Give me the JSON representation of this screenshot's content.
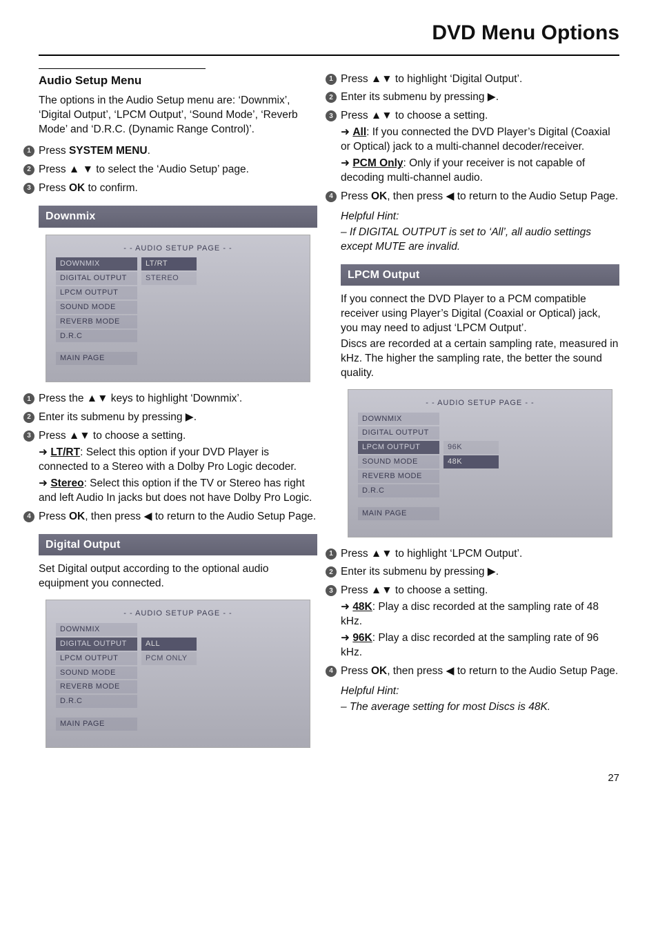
{
  "page": {
    "title": "DVD Menu Options",
    "number": "27"
  },
  "left": {
    "heading": "Audio Setup Menu",
    "intro": "The options in the Audio Setup menu are: ‘Downmix’, ‘Digital Output’, ‘LPCM Output’, ‘Sound Mode’, ‘Reverb Mode’ and ‘D.R.C. (Dynamic Range Control)’.",
    "step1_a": "Press ",
    "step1_b": "SYSTEM MENU",
    "step1_c": ".",
    "step2": "Press ▲ ▼ to select the ‘Audio Setup’ page.",
    "step3_a": "Press ",
    "step3_b": "OK",
    "step3_c": " to confirm.",
    "sub_downmix": "Downmix",
    "osd1": {
      "title": "- - AUDIO SETUP PAGE - -",
      "items": [
        "DOWNMIX",
        "DIGITAL OUTPUT",
        "LPCM OUTPUT",
        "SOUND MODE",
        "REVERB MODE",
        "D.R.C"
      ],
      "opts": [
        "LT/RT",
        "STEREO"
      ],
      "sel_item": 0,
      "sel_opt": 0,
      "main": "MAIN PAGE"
    },
    "d1": "Press the ▲▼ keys to highlight ‘Downmix’.",
    "d2": "Enter its submenu by pressing ▶.",
    "d3": "Press ▲▼ to choose a setting.",
    "d3_opt1_lab": "LT/RT",
    "d3_opt1_txt": ": Select this option if your DVD Player is connected to a Stereo with a Dolby Pro Logic decoder.",
    "d3_opt2_lab": "Stereo",
    "d3_opt2_txt": ": Select this option if the TV or Stereo has right and left Audio In jacks but does not have Dolby Pro Logic.",
    "d4_a": "Press ",
    "d4_b": "OK",
    "d4_c": ", then press ◀ to return to the Audio Setup Page.",
    "sub_digital": "Digital Output",
    "digital_intro": "Set Digital output according to the optional audio equipment you connected.",
    "osd2": {
      "title": "- - AUDIO SETUP PAGE - -",
      "items": [
        "DOWNMIX",
        "DIGITAL OUTPUT",
        "LPCM OUTPUT",
        "SOUND MODE",
        "REVERB MODE",
        "D.R.C"
      ],
      "opts": [
        "ALL",
        "PCM ONLY"
      ],
      "sel_item": 1,
      "sel_opt": 0,
      "main": "MAIN PAGE"
    }
  },
  "right": {
    "g1": "Press ▲▼ to highlight ‘Digital Output’.",
    "g2": "Enter its submenu by pressing ▶.",
    "g3": "Press ▲▼ to choose a setting.",
    "g3_opt1_lab": "All",
    "g3_opt1_txt": ": If you connected the DVD Player’s Digital (Coaxial or Optical) jack to a multi-channel decoder/receiver.",
    "g3_opt2_lab": "PCM Only",
    "g3_opt2_txt": ": Only if your receiver is not capable of decoding multi-channel audio.",
    "g4_a": "Press ",
    "g4_b": "OK",
    "g4_c": ", then press ◀ to return to the Audio Setup Page.",
    "hint1_head": "Helpful Hint:",
    "hint1_body": "–   If DIGITAL OUTPUT is set to ‘All’, all audio settings except MUTE are invalid.",
    "sub_lpcm": "LPCM Output",
    "lpcm_p1": "If you connect the DVD Player to a PCM compatible receiver using Player’s Digital (Coaxial or Optical) jack, you may need to adjust ‘LPCM Output’.",
    "lpcm_p2": "Discs are recorded at a certain sampling rate, measured in kHz. The higher the sampling rate, the better the sound quality.",
    "osd3": {
      "title": "- - AUDIO SETUP PAGE - -",
      "items": [
        "DOWNMIX",
        "DIGITAL OUTPUT",
        "LPCM OUTPUT",
        "SOUND MODE",
        "REVERB MODE",
        "D.R.C"
      ],
      "opts": [
        "96K",
        "48K"
      ],
      "sel_item": 2,
      "sel_opt": 1,
      "main": "MAIN PAGE"
    },
    "l1": "Press ▲▼ to highlight ‘LPCM Output’.",
    "l2": "Enter its submenu by pressing ▶.",
    "l3": "Press ▲▼ to choose a setting.",
    "l3_opt1_lab": "48K",
    "l3_opt1_txt": ": Play a disc recorded at the sampling rate of 48 kHz.",
    "l3_opt2_lab": "96K",
    "l3_opt2_txt": ": Play a disc recorded at the sampling rate of 96 kHz.",
    "l4_a": "Press ",
    "l4_b": "OK",
    "l4_c": ", then press ◀ to return to the Audio Setup Page.",
    "hint2_head": "Helpful Hint:",
    "hint2_body": "–   The average setting for most Discs is 48K."
  },
  "glyphs": {
    "optarrow": "➜"
  }
}
